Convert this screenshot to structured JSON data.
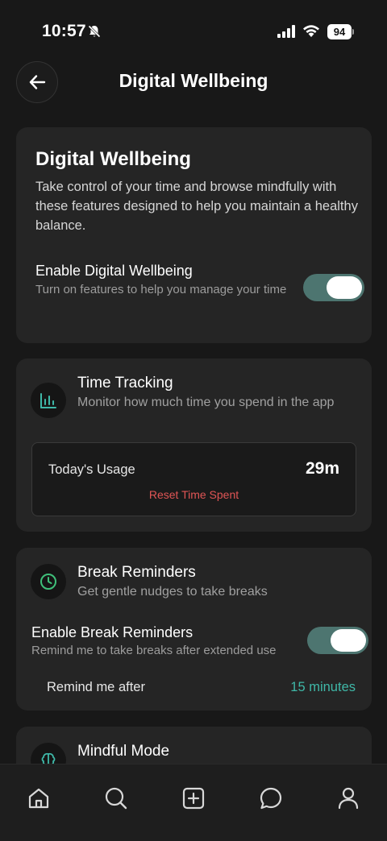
{
  "status_bar": {
    "time": "10:57",
    "battery": "94"
  },
  "header": {
    "title": "Digital Wellbeing",
    "back_icon": "arrow-left-icon"
  },
  "intro": {
    "title": "Digital Wellbeing",
    "description": "Take control of your time and browse mindfully with these features designed to help you maintain a healthy balance.",
    "enable_title": "Enable Digital Wellbeing",
    "enable_subtitle": "Turn on features to help you manage your time",
    "enabled": true
  },
  "time_tracking": {
    "title": "Time Tracking",
    "subtitle": "Monitor how much time you spend in the app",
    "icon": "bar-chart-icon",
    "usage_label": "Today's Usage",
    "usage_value": "29m",
    "reset_label": "Reset Time Spent"
  },
  "break_reminders": {
    "title": "Break Reminders",
    "subtitle": "Get gentle nudges to take breaks",
    "icon": "clock-icon",
    "enable_title": "Enable Break Reminders",
    "enable_subtitle": "Remind me to take breaks after extended use",
    "enabled": true,
    "remind_label": "Remind me after",
    "remind_value": "15 minutes"
  },
  "mindful_mode": {
    "title": "Mindful Mode",
    "icon": "brain-icon"
  },
  "bottom_nav": {
    "items": [
      "home-icon",
      "search-icon",
      "add-post-icon",
      "messages-icon",
      "profile-icon"
    ]
  },
  "colors": {
    "background": "#181818",
    "card": "#252525",
    "toggle_on": "#4d7570",
    "accent_teal": "#3fb8a8",
    "danger": "#e05555"
  }
}
